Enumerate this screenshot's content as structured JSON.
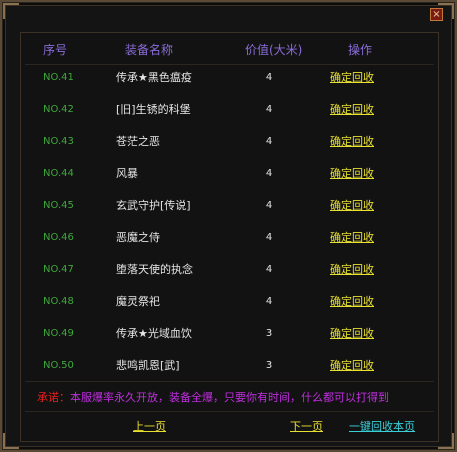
{
  "window": {
    "close_label": "×"
  },
  "table": {
    "headers": {
      "index": "序号",
      "name": "装备名称",
      "value": "价值(大米)",
      "action": "操作"
    },
    "rows": [
      {
        "index": "NO.41",
        "name": "传承★黑色瘟疫",
        "value": "4",
        "action": "确定回收"
      },
      {
        "index": "NO.42",
        "name": "[旧]生锈的科堡",
        "value": "4",
        "action": "确定回收"
      },
      {
        "index": "NO.43",
        "name": "苍茫之恶",
        "value": "4",
        "action": "确定回收"
      },
      {
        "index": "NO.44",
        "name": "风暴",
        "value": "4",
        "action": "确定回收"
      },
      {
        "index": "NO.45",
        "name": "玄武守护[传说]",
        "value": "4",
        "action": "确定回收"
      },
      {
        "index": "NO.46",
        "name": "恶魔之侍",
        "value": "4",
        "action": "确定回收"
      },
      {
        "index": "NO.47",
        "name": "堕落天使的执念",
        "value": "4",
        "action": "确定回收"
      },
      {
        "index": "NO.48",
        "name": "魔灵祭祀",
        "value": "4",
        "action": "确定回收"
      },
      {
        "index": "NO.49",
        "name": "传承★光域血饮",
        "value": "3",
        "action": "确定回收"
      },
      {
        "index": "NO.50",
        "name": "悲鸣凯恩[武]",
        "value": "3",
        "action": "确定回收"
      }
    ]
  },
  "notice": {
    "label": "承诺：",
    "text": "本服爆率永久开放，装备全爆，只要你有时间，什么都可以打得到"
  },
  "nav": {
    "prev": "上一页",
    "next": "下一页",
    "recycle_all": "一键回收本页"
  },
  "colors": {
    "index": "#3fa83c",
    "header": "#8a6cd8",
    "action": "#e8e030",
    "notice_label": "#e8201e",
    "notice_text": "#c02ee0",
    "recycle_all": "#3ad0d8"
  }
}
